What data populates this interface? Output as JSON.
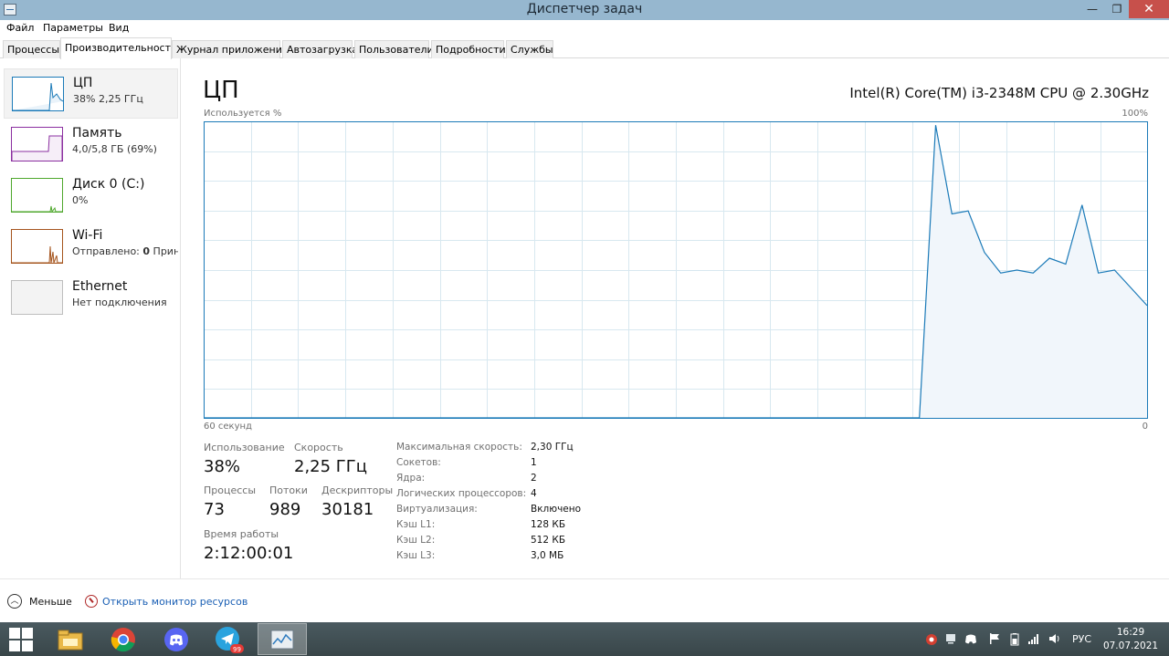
{
  "window": {
    "title": "Диспетчер задач",
    "minimize": "—",
    "maximize": "❐",
    "close": "✕"
  },
  "menu": [
    "Файл",
    "Параметры",
    "Вид"
  ],
  "tabs": [
    {
      "label": "Процессы"
    },
    {
      "label": "Производительность",
      "active": true
    },
    {
      "label": "Журнал приложений"
    },
    {
      "label": "Автозагрузка"
    },
    {
      "label": "Пользователи"
    },
    {
      "label": "Подробности"
    },
    {
      "label": "Службы"
    }
  ],
  "sidebar": [
    {
      "title": "ЦП",
      "sub": "38% 2,25 ГГц",
      "color": "#1b7ab8",
      "selected": true
    },
    {
      "title": "Память",
      "sub": "4,0/5,8 ГБ (69%)",
      "color": "#8b2fa0"
    },
    {
      "title": "Диск 0 (C:)",
      "sub": "0%",
      "color": "#4ea72c"
    },
    {
      "title": "Wi-Fi",
      "sub_prefix": "Отправлено: ",
      "sub_bold": "0",
      "sub_suffix": " Принят",
      "color": "#a5541d"
    },
    {
      "title": "Ethernet",
      "sub": "Нет подключения",
      "color": "#bdbdbd"
    }
  ],
  "main": {
    "title": "ЦП",
    "cpu_model": "Intel(R) Core(TM) i3-2348M CPU @ 2.30GHz",
    "graph_label_top_left": "Используется %",
    "graph_label_top_right": "100%",
    "graph_label_bottom_left": "60 секунд",
    "graph_label_bottom_right": "0",
    "graph_color": "#1b7ab8",
    "graph_fill": "#f1f6fb",
    "graph_grid": "#d8e8f0",
    "cpu_usage_history": [
      0,
      0,
      0,
      0,
      0,
      0,
      0,
      0,
      0,
      0,
      0,
      0,
      0,
      0,
      0,
      0,
      0,
      0,
      0,
      0,
      0,
      0,
      0,
      0,
      0,
      0,
      0,
      0,
      0,
      0,
      0,
      0,
      0,
      0,
      0,
      0,
      0,
      0,
      0,
      0,
      0,
      0,
      0,
      0,
      0,
      99,
      69,
      70,
      56,
      49,
      50,
      49,
      54,
      52,
      72,
      49,
      50,
      44,
      38
    ]
  },
  "stats": {
    "usage_label": "Использование",
    "usage_value": "38%",
    "speed_label": "Скорость",
    "speed_value": "2,25 ГГц",
    "processes_label": "Процессы",
    "processes_value": "73",
    "threads_label": "Потоки",
    "threads_value": "989",
    "handles_label": "Дескрипторы",
    "handles_value": "30181",
    "uptime_label": "Время работы",
    "uptime_value": "2:12:00:01"
  },
  "details": [
    {
      "key": "Максимальная скорость:",
      "value": "2,30 ГГц"
    },
    {
      "key": "Сокетов:",
      "value": "1"
    },
    {
      "key": "Ядра:",
      "value": "2"
    },
    {
      "key": "Логических процессоров:",
      "value": "4"
    },
    {
      "key": "Виртуализация:",
      "value": "Включено"
    },
    {
      "key": "Кэш L1:",
      "value": "128 КБ"
    },
    {
      "key": "Кэш L2:",
      "value": "512 КБ"
    },
    {
      "key": "Кэш L3:",
      "value": "3,0 МБ"
    }
  ],
  "footer": {
    "less": "Меньше",
    "resource_monitor": "Открыть монитор ресурсов"
  },
  "taskbar": {
    "apps": [
      "file-explorer-icon",
      "chrome-icon",
      "discord-icon",
      "telegram-icon",
      "task-manager-icon"
    ],
    "telegram_badge": "99",
    "language": "РУС",
    "time": "16:29",
    "date": "07.07.2021"
  }
}
